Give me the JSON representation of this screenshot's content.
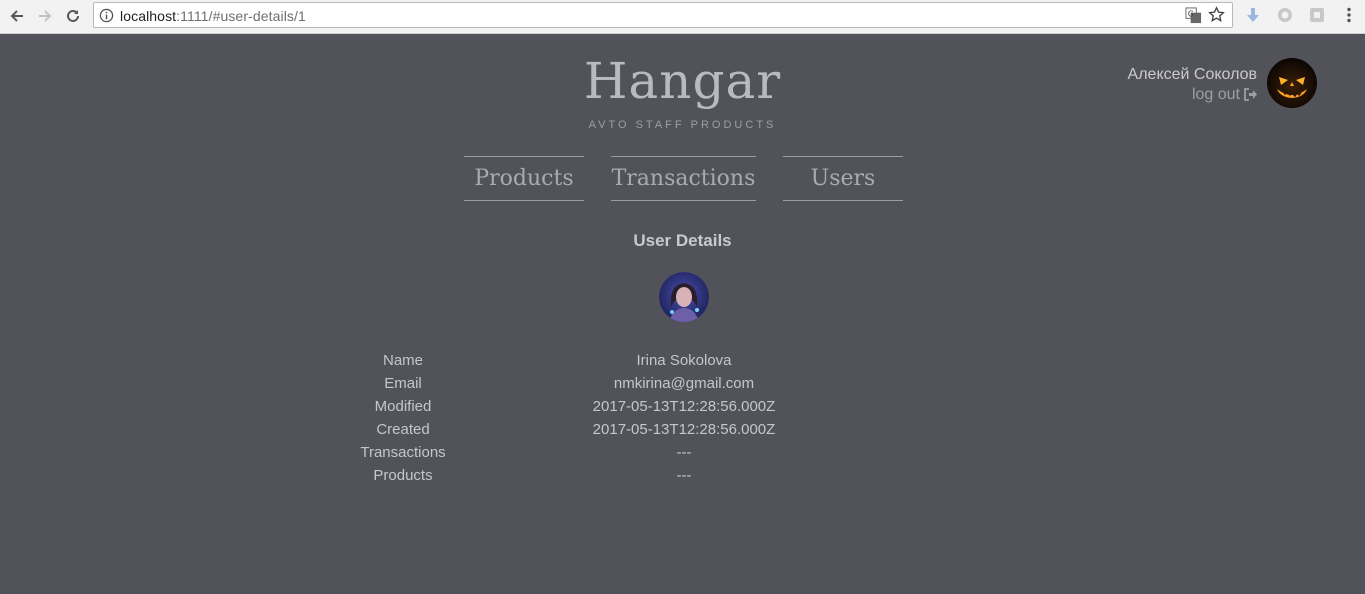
{
  "browser": {
    "url_host": "localhost",
    "url_rest": ":1111/#user-details/1"
  },
  "header": {
    "logo": "Hangar",
    "tagline": "AVTO STAFF PRODUCTS",
    "user_name": "Алексей Соколов",
    "logout_label": "log out"
  },
  "nav": {
    "products": "Products",
    "transactions": "Transactions",
    "users": "Users"
  },
  "details": {
    "title": "User Details",
    "rows": [
      {
        "label": "Name",
        "value": "Irina Sokolova"
      },
      {
        "label": "Email",
        "value": "nmkirina@gmail.com"
      },
      {
        "label": "Modified",
        "value": "2017-05-13T12:28:56.000Z"
      },
      {
        "label": "Created",
        "value": "2017-05-13T12:28:56.000Z"
      },
      {
        "label": "Transactions",
        "value": "---"
      },
      {
        "label": "Products",
        "value": "---"
      }
    ]
  },
  "colors": {
    "background": "#52535a",
    "text": "#c5c5c8",
    "logo": "#b9babe"
  }
}
